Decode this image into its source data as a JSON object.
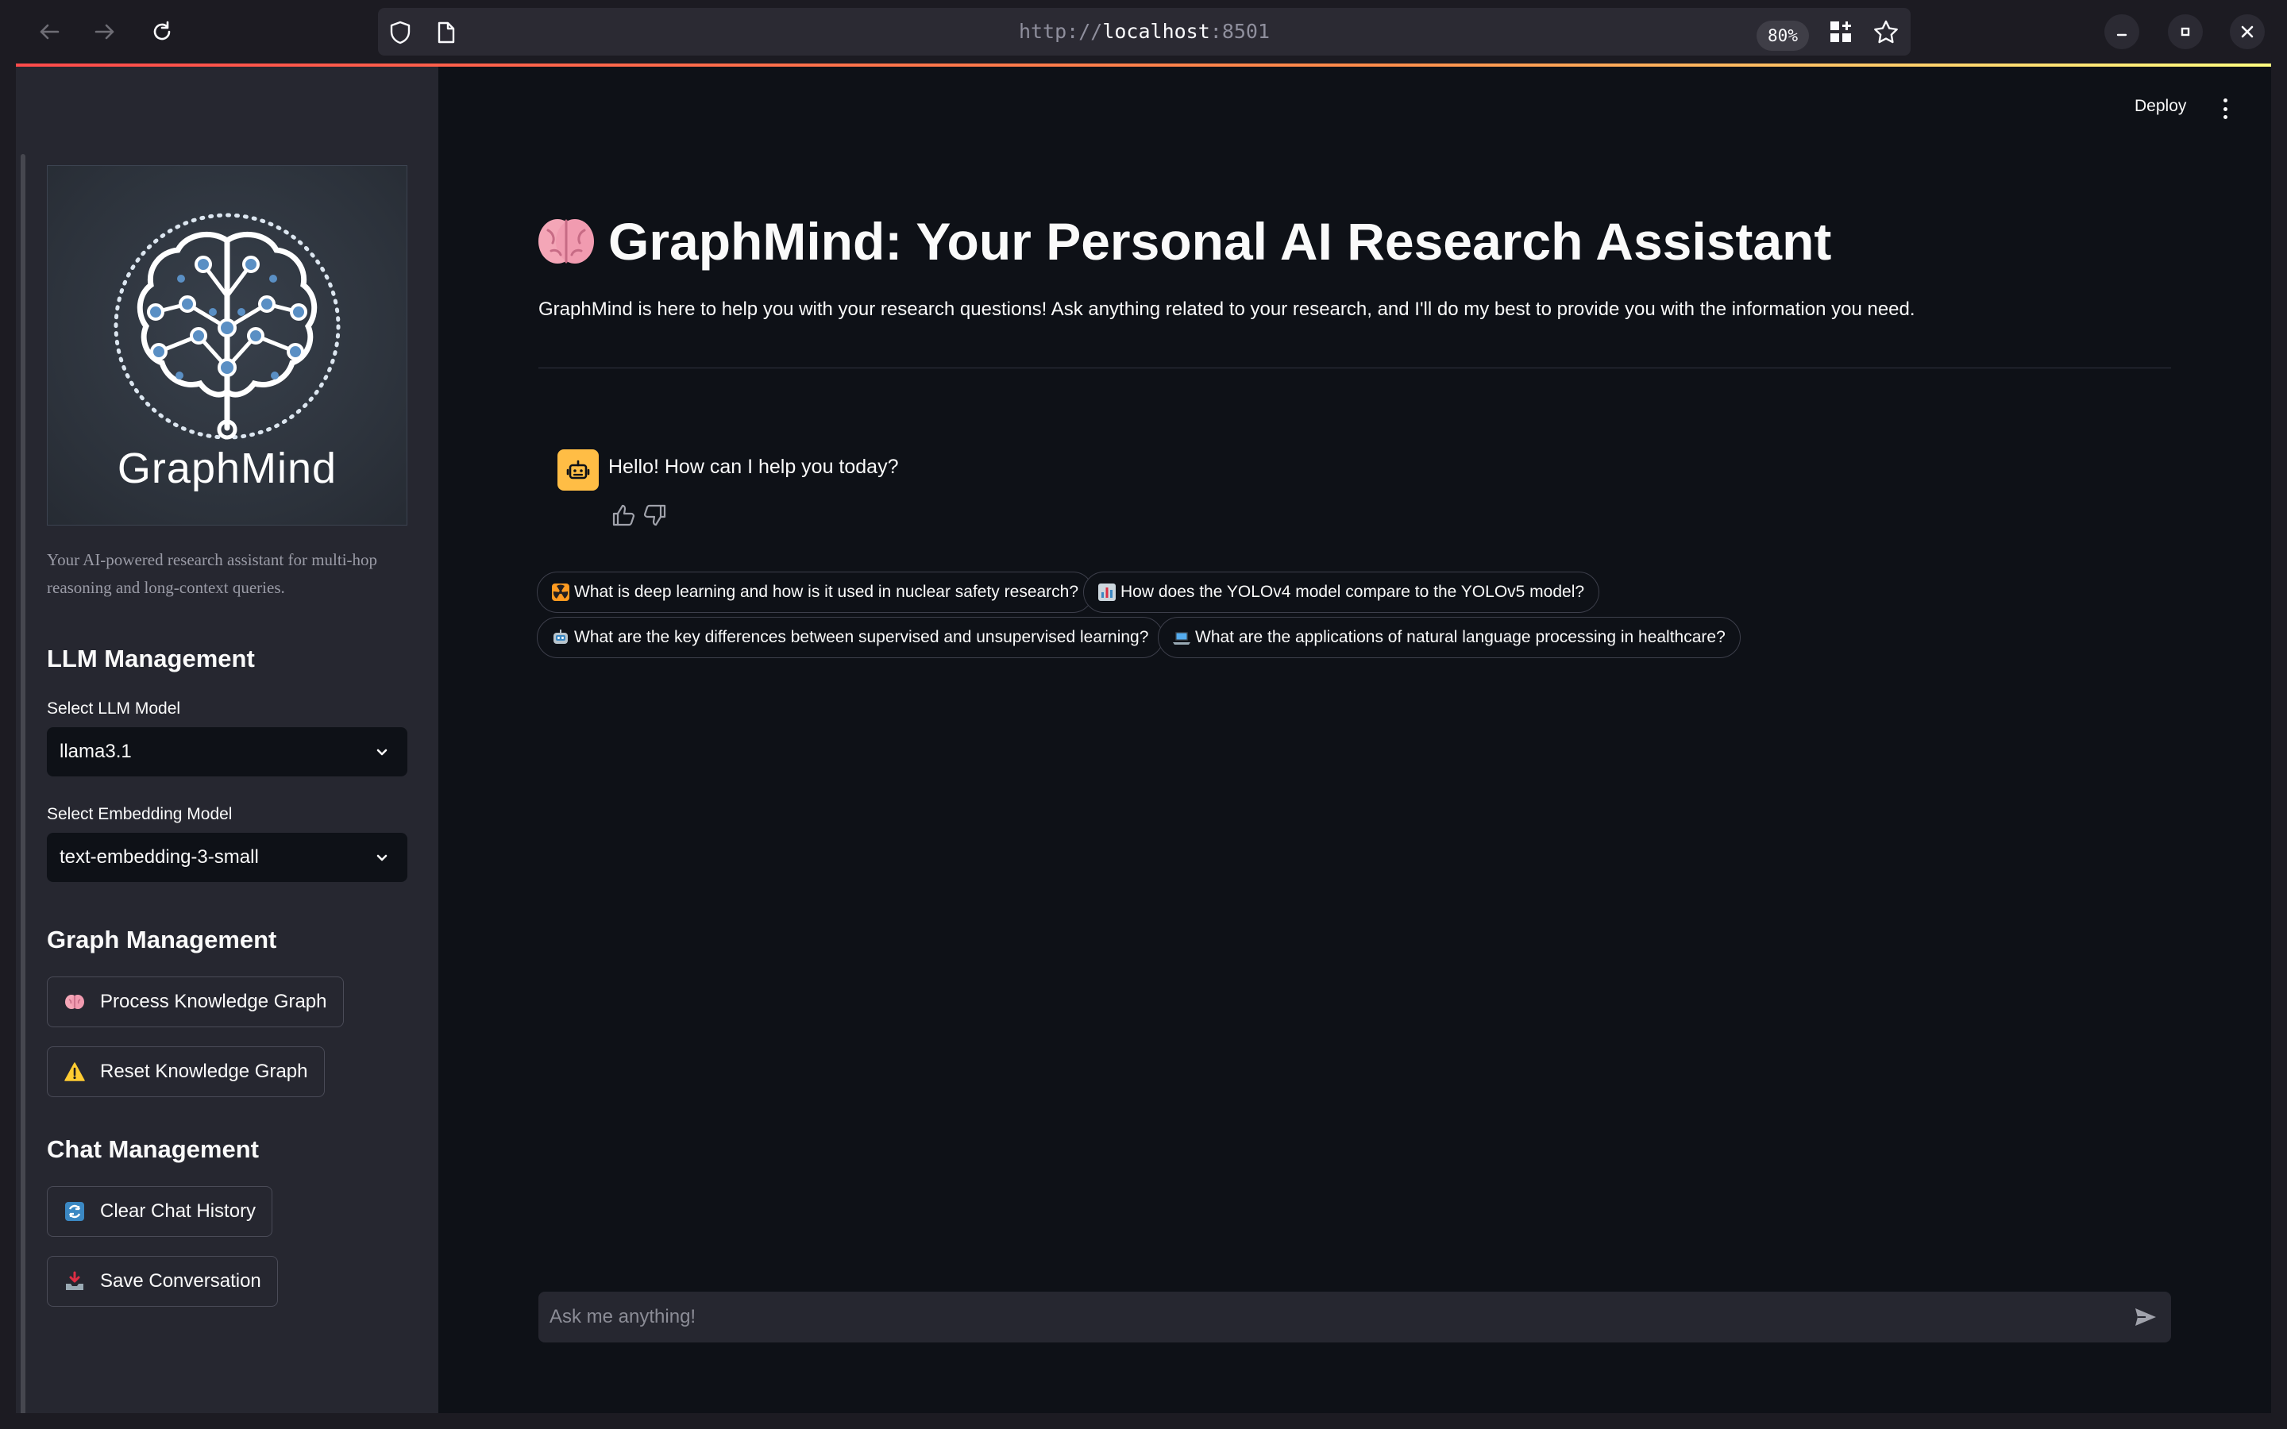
{
  "browser": {
    "url_scheme": "http://",
    "url_host": "localhost",
    "url_port": ":8501",
    "zoom": "80%"
  },
  "toolbar": {
    "deploy_label": "Deploy"
  },
  "sidebar": {
    "logo_text": "GraphMind",
    "description": "Your AI-powered research assistant for multi-hop reasoning and long-context queries.",
    "llm_heading": "LLM Management",
    "llm_model_label": "Select LLM Model",
    "llm_model_value": "llama3.1",
    "embedding_label": "Select Embedding Model",
    "embedding_value": "text-embedding-3-small",
    "graph_heading": "Graph Management",
    "process_graph_label": "Process Knowledge Graph",
    "reset_graph_label": "Reset Knowledge Graph",
    "chat_heading": "Chat Management",
    "clear_history_label": "Clear Chat History",
    "save_conversation_label": "Save Conversation"
  },
  "main": {
    "title": "GraphMind: Your Personal AI Research Assistant",
    "intro": "GraphMind is here to help you with your research questions! Ask anything related to your research, and I'll do my best to provide you with the information you need.",
    "assistant_message": "Hello! How can I help you today?",
    "suggestions": [
      {
        "icon": "radioactive-icon",
        "text": "What is deep learning and how is it used in nuclear safety research?"
      },
      {
        "icon": "bar-chart-icon",
        "text": "How does the YOLOv4 model compare to the YOLOv5 model?"
      },
      {
        "icon": "robot-icon",
        "text": "What are the key differences between supervised and unsupervised learning?"
      },
      {
        "icon": "laptop-icon",
        "text": "What are the applications of natural language processing in healthcare?"
      }
    ],
    "chat_placeholder": "Ask me anything!"
  },
  "colors": {
    "background": "#0e1117",
    "sidebar": "#262730",
    "avatar": "#ffbd45",
    "accent_gradient_start": "#ff4b4b",
    "accent_gradient_end": "#fffd80"
  }
}
